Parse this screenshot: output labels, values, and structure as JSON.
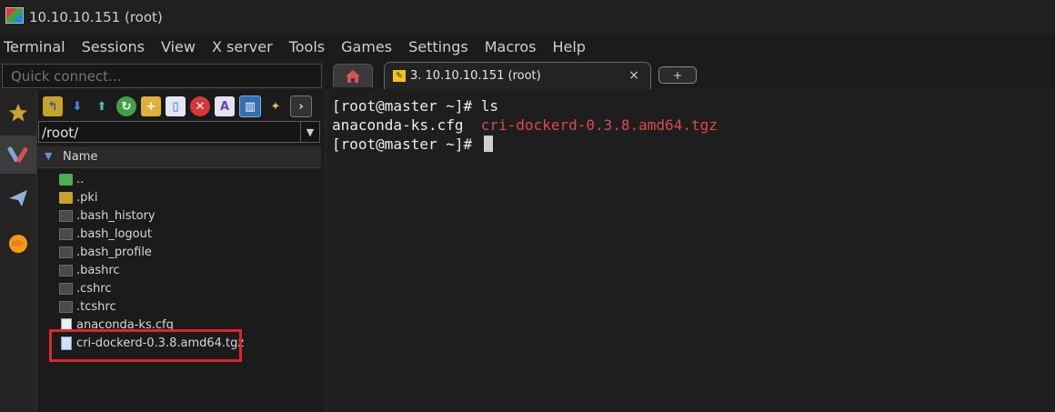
{
  "window": {
    "title": "10.10.10.151 (root)"
  },
  "menu": [
    "Terminal",
    "Sessions",
    "View",
    "X server",
    "Tools",
    "Games",
    "Settings",
    "Macros",
    "Help"
  ],
  "quick_connect": {
    "placeholder": "Quick connect..."
  },
  "sidebar": {
    "icons": [
      "star-icon",
      "tools-icon",
      "send-icon",
      "globe-icon"
    ]
  },
  "sftp": {
    "toolbar_icons": [
      "parent-folder-icon",
      "download-icon",
      "upload-icon",
      "refresh-icon",
      "new-folder-icon",
      "new-file-icon",
      "delete-icon",
      "rename-icon",
      "view-icon",
      "magic-icon",
      "terminal-icon"
    ],
    "path": "/root/",
    "column_name": "Name",
    "files": [
      {
        "name": "..",
        "type": "up"
      },
      {
        "name": ".pki",
        "type": "folder"
      },
      {
        "name": ".bash_history",
        "type": "file"
      },
      {
        "name": ".bash_logout",
        "type": "file"
      },
      {
        "name": ".bash_profile",
        "type": "file"
      },
      {
        "name": ".bashrc",
        "type": "file"
      },
      {
        "name": ".cshrc",
        "type": "file"
      },
      {
        "name": ".tcshrc",
        "type": "file"
      },
      {
        "name": "anaconda-ks.cfg",
        "type": "doc"
      },
      {
        "name": "cri-dockerd-0.3.8.amd64.tgz",
        "type": "archive"
      }
    ]
  },
  "tabs": {
    "session_label": "3. 10.10.10.151 (root)",
    "close_glyph": "×",
    "new_tab_glyph": "+"
  },
  "terminal": {
    "line1": "[root@master ~]# ls",
    "file1": "anaconda-ks.cfg",
    "file2": "cri-dockerd-0.3.8.amd64.tgz",
    "line3": "[root@master ~]# "
  },
  "colors": {
    "highlight": "#e0252a",
    "archive_text": "#e0494a"
  }
}
